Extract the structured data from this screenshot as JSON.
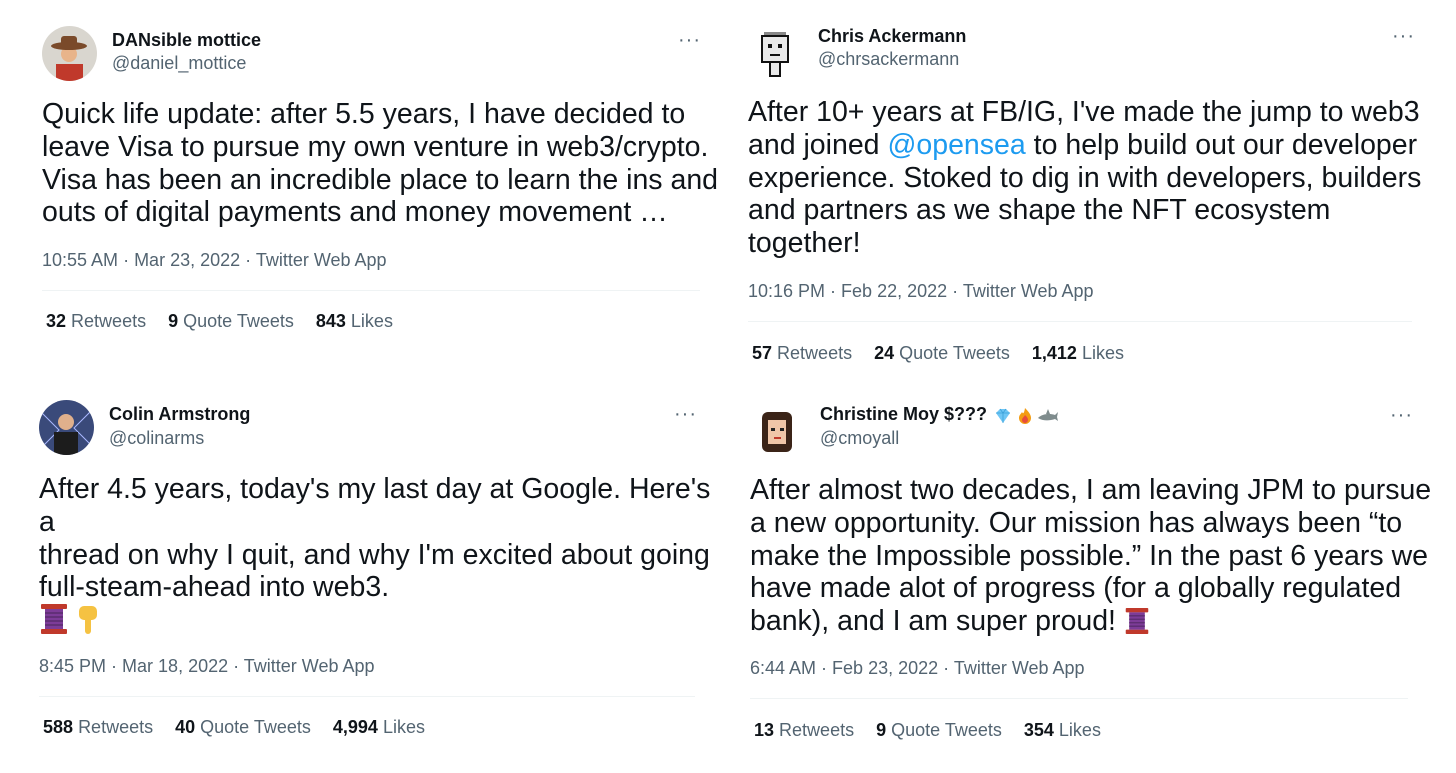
{
  "tweets": [
    {
      "name": "DANsible mottice",
      "handle": "@daniel_mottice",
      "lines": [
        "Quick life update: after 5.5 years, I have decided to",
        "leave Visa to pursue my own venture in web3/crypto.",
        "Visa has been an incredible place to learn the ins and",
        "outs of digital payments and money movement …"
      ],
      "time": "10:55 AM",
      "date": "Mar 23, 2022",
      "source": "Twitter Web App",
      "retweets": "32",
      "retweets_label": "Retweets",
      "quotes": "9",
      "quotes_label": "Quote Tweets",
      "likes": "843",
      "likes_label": "Likes"
    },
    {
      "name": "Chris Ackermann",
      "handle": "@chrsackermann",
      "line1": "After 10+ years at FB/IG, I've made the jump to web3",
      "line2_pre": "and joined ",
      "mention": "@opensea",
      "line2_post": " to help build out our developer",
      "line3": "experience. Stoked to dig in with developers, builders",
      "line4": "and partners as we shape the NFT ecosystem",
      "line5": "together!",
      "time": "10:16 PM",
      "date": "Feb 22, 2022",
      "source": "Twitter Web App",
      "retweets": "57",
      "retweets_label": "Retweets",
      "quotes": "24",
      "quotes_label": "Quote Tweets",
      "likes": "1,412",
      "likes_label": "Likes"
    },
    {
      "name": "Colin Armstrong",
      "handle": "@colinarms",
      "lines": [
        "After 4.5 years, today's my last day at Google. Here's a",
        "thread on why I quit, and why I'm excited about going",
        "full-steam-ahead into web3."
      ],
      "emoji_icons": [
        "thread-spool-icon",
        "pointing-down-icon"
      ],
      "time": "8:45 PM",
      "date": "Mar 18, 2022",
      "source": "Twitter Web App",
      "retweets": "588",
      "retweets_label": "Retweets",
      "quotes": "40",
      "quotes_label": "Quote Tweets",
      "likes": "4,994",
      "likes_label": "Likes"
    },
    {
      "name": "Christine Moy $???",
      "name_badges": [
        "diamond-icon",
        "fire-icon",
        "shark-icon"
      ],
      "handle": "@cmoyall",
      "lines": [
        "After almost two decades, I am leaving JPM to pursue",
        "a new opportunity. Our mission has always been “to",
        "make the Impossible possible.” In the past 6 years we",
        "have made alot of progress (for a globally regulated"
      ],
      "last_line": "bank), and I am super proud! ",
      "last_emoji": "thread-spool-icon",
      "time": "6:44 AM",
      "date": "Feb 23, 2022",
      "source": "Twitter Web App",
      "retweets": "13",
      "retweets_label": "Retweets",
      "quotes": "9",
      "quotes_label": "Quote Tweets",
      "likes": "354",
      "likes_label": "Likes"
    }
  ],
  "more_glyph": "···",
  "separator": " · ",
  "colors": {
    "text": "#0f1419",
    "muted": "#536471",
    "link": "#1d9bf0",
    "divider": "#eff3f4"
  }
}
